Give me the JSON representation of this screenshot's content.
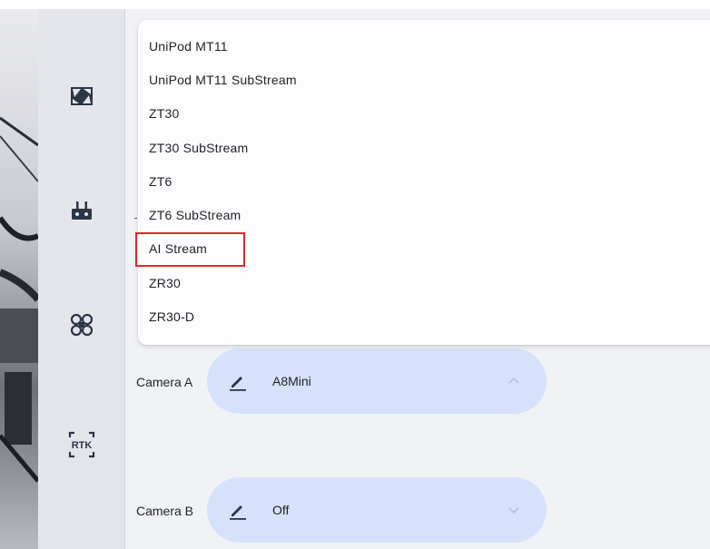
{
  "dropdown": {
    "items": [
      {
        "label": "UniPod MT11"
      },
      {
        "label": "UniPod MT11 SubStream"
      },
      {
        "label": "ZT30"
      },
      {
        "label": "ZT30 SubStream"
      },
      {
        "label": "ZT6"
      },
      {
        "label": "ZT6 SubStream"
      },
      {
        "label": "AI Stream"
      },
      {
        "label": "ZR30"
      },
      {
        "label": "ZR30-D"
      }
    ],
    "highlighted": "AI Stream"
  },
  "rail": {
    "icons": [
      "camera-icon",
      "remote-controller-icon",
      "drone-icon",
      "rtk-icon"
    ],
    "rtk_text": "RTK"
  },
  "cameras": {
    "a": {
      "label": "Camera A",
      "value": "A8Mini",
      "state": "expanded"
    },
    "b": {
      "label": "Camera B",
      "value": "Off",
      "state": "collapsed"
    }
  },
  "colors": {
    "select_bg": "#d6e2fb",
    "highlight_border": "#d92b2b",
    "rail_bg": "#e4e6ec"
  }
}
